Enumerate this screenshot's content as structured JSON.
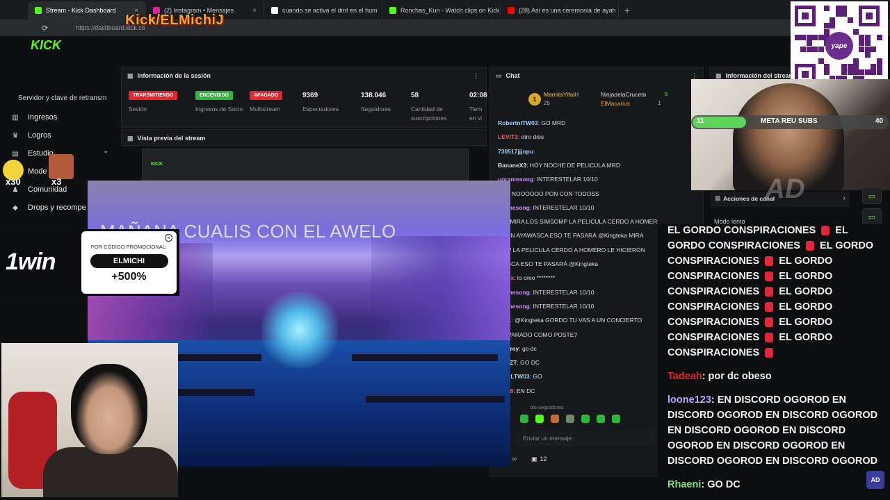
{
  "browser": {
    "tabs": [
      {
        "label": "Stream - Kick Dashboard",
        "color": "#53fc18",
        "active": true
      },
      {
        "label": "(2) Instagram • Mensajes",
        "color": "#d6249f",
        "active": false
      },
      {
        "label": "cuando se activa el dmt en el hum",
        "color": "#ffffff",
        "active": false
      },
      {
        "label": "Ronchas_Kun - Watch clips on Kick",
        "color": "#53fc18",
        "active": false
      },
      {
        "label": "(28) Así es una ceremonia de ayah",
        "color": "#ff0000",
        "active": false
      }
    ],
    "url": "https://dashboard.kick.co"
  },
  "overlay": {
    "channel_logo": "Kick/ELMichiJ",
    "kick_wordmark": "KICK",
    "stream_title_overlay": "MAÑANA CUALIS CON EL AWELO",
    "emote_counts": [
      "x30",
      "x3"
    ],
    "promo": {
      "brand": "1win",
      "caption": "POR CÓDIGO PROMOCIONAL:",
      "code": "ELMICHI",
      "bonus": "+500%"
    },
    "qr_brand": "yape",
    "meta_goal": {
      "label": "META REU SUBS",
      "current": "11",
      "target": "40",
      "progress": 0.275
    },
    "watermark": "AD",
    "corner_logo": "AD"
  },
  "sidebar": {
    "truncated_top": "Servidor y clave de retransm",
    "items": [
      {
        "label": "Ingresos",
        "icon": "chart-icon"
      },
      {
        "label": "Logros",
        "icon": "trophy-icon"
      },
      {
        "label": "Estudio",
        "icon": "studio-icon"
      },
      {
        "label": "Mode",
        "icon": "shield-icon"
      },
      {
        "label": "Comunidad",
        "icon": "users-icon"
      },
      {
        "label": "Drops y recompe",
        "icon": "gift-icon"
      }
    ]
  },
  "session": {
    "title": "Información de la sesión",
    "badges": [
      {
        "label": "TRANSMITIENDO",
        "caption": "Sesión",
        "color": "#e5252b"
      },
      {
        "label": "ENCENDIDO",
        "caption": "Ingresos de Socio",
        "color": "#2fb73b"
      },
      {
        "label": "APAGADO",
        "caption": "Multistream",
        "color": "#e5252b"
      }
    ],
    "stats": [
      {
        "value": "9369",
        "label": "Espectadores"
      },
      {
        "value": "138.046",
        "label": "Seguidores"
      },
      {
        "value": "58",
        "label": "Cantidad de suscripciones"
      },
      {
        "value": "02:08",
        "label": "Tiem en vi"
      }
    ]
  },
  "preview": {
    "title": "Vista previa del stream"
  },
  "chat": {
    "title": "Chat",
    "top_users": [
      {
        "name": "MamitaYifaiH",
        "count": "25"
      },
      {
        "name": "NinjadelaCruceta",
        "count": "5"
      },
      {
        "name": "ElMacarius",
        "count": "1"
      }
    ],
    "messages": [
      {
        "user": "RobertnlTW03",
        "text": ": GO MRD",
        "color": "#9ad0ff"
      },
      {
        "user": "LEVIT3",
        "text": ": otro dios",
        "color": "#ff5a5a"
      },
      {
        "user": "730517jjjopu",
        "text": ":",
        "color": "#9ad0ff"
      },
      {
        "user": "BananeX3",
        "text": ": HOY NOCHE DE PELICULA MRD",
        "color": "#dddddd"
      },
      {
        "user": "uoramesong",
        "text": ": INTERESTELAR 10/10",
        "color": "#d08bff"
      },
      {
        "user": "son",
        "text": ": NOOOOOO PON CON TODOSS",
        "color": "#dddddd"
      },
      {
        "user": "oramesong",
        "text": ": INTERESTELAR 10/10",
        "color": "#d08bff"
      },
      {
        "user": "er0",
        "text": ": MIRA LOS SIMSOMP LA PELICULA CERDO A HOMERO LE",
        "color": "#ff9a4a"
      },
      {
        "user": "",
        "text": "ERON AYAWASCA ESO TE PASARÁ @Kingteka MIRA",
        "color": "#dddddd"
      },
      {
        "user": "",
        "text": "OMP LA PELICULA CERDO A HOMERO LE HICIERON",
        "color": "#dddddd"
      },
      {
        "user": "",
        "text": "WASCA ESO TE PASARÁ @Kingteka",
        "color": "#dddddd"
      },
      {
        "user": "_Biox",
        "text": ": lo creo ********",
        "color": "#ff5a5a"
      },
      {
        "user": "oramesong",
        "text": ": INTERESTELAR 10/10",
        "color": "#d08bff"
      },
      {
        "user": "oramesong",
        "text": ": INTERESTELAR 10/10",
        "color": "#d08bff"
      },
      {
        "user": "en01",
        "text": ": @Kingteka GORDO TU VAS A UN CONCIERTO",
        "color": "#ff9a4a"
      },
      {
        "user": "",
        "text": "AR PARADO COMO POSTE?",
        "color": "#dddddd"
      },
      {
        "user": "octerey",
        "text": ": go dc",
        "color": "#dddddd"
      },
      {
        "user": "ASZZT",
        "text": ": GO DC",
        "color": "#dddddd"
      },
      {
        "user": "erthILTW03",
        "text": ": GO",
        "color": "#9ad0ff"
      },
      {
        "user": "Lin88",
        "text": ": EN DC",
        "color": "#ff5a5a"
      },
      {
        "user": "one",
        "text": ":",
        "color": "#dddddd"
      }
    ],
    "followers_only": "olo seguidores",
    "input_placeholder": "Enviar un mensaje",
    "viewer_count": "12"
  },
  "channel_info": {
    "title": "Información del stream",
    "actions": "Acciones de canal",
    "slow_mode": "Modo lento"
  },
  "big_chat": [
    {
      "user": "",
      "text": "EL GORDO CONSPIRACIONES [h] EL GORDO CONSPIRACIONES [h] EL GORDO CONSPIRACIONES [h] EL GORDO CONSPIRACIONES [h] EL GORDO CONSPIRACIONES [h] EL GORDO CONSPIRACIONES [h] EL GORDO CONSPIRACIONES [h] EL GORDO CONSPIRACIONES [h] EL GORDO CONSPIRACIONES [h]",
      "color": "#ffffff"
    },
    {
      "user": "Tadeah",
      "text": ": por dc obeso",
      "color": "#e5252b"
    },
    {
      "user": "loone123",
      "text": ": EN DISCORD OGOROD EN DISCORD OGOROD EN DISCORD OGOROD EN DISCORD OGOROD EN DISCORD OGOROD EN DISCORD OGOROD EN DISCORD OGOROD EN DISCORD OGOROD",
      "color": "#b7a6ff"
    },
    {
      "user": "Rhaeni",
      "text": ": GO DC",
      "color": "#7ee08a"
    }
  ]
}
